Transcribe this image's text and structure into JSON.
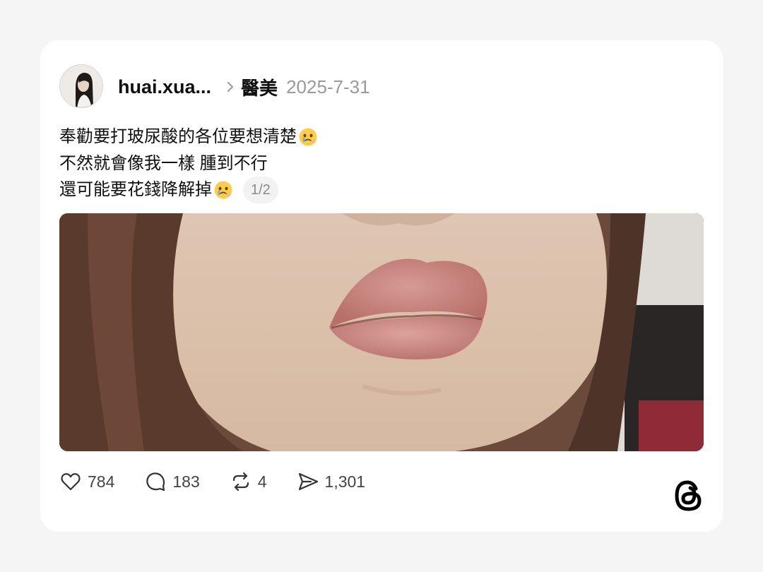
{
  "post": {
    "username": "huai.xua...",
    "topic": "醫美",
    "date": "2025-7-31",
    "text_lines": [
      "奉勸要打玻尿酸的各位要想清楚",
      "不然就會像我一樣 腫到不行",
      "還可能要花錢降解掉"
    ],
    "image_counter": "1/2",
    "image_description_icon": "swollen-lips-photo"
  },
  "actions": {
    "likes": "784",
    "comments": "183",
    "reposts": "4",
    "shares": "1,301"
  },
  "icons": {
    "like": "heart-icon",
    "comment": "comment-bubble-icon",
    "repost": "repost-icon",
    "share": "send-icon",
    "brand": "threads-logo-icon",
    "emoji": "face-holding-back-tears-emoji"
  },
  "colors": {
    "background": "#f5f5f5",
    "card": "#ffffff",
    "text": "#101010",
    "muted": "#9a9a9a"
  }
}
